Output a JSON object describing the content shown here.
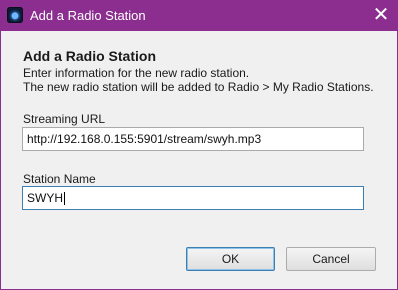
{
  "window": {
    "title": "Add a Radio Station",
    "close_label": "✕"
  },
  "dialog": {
    "heading": "Add a Radio Station",
    "description_line1": "Enter information for the new radio station.",
    "description_line2": "The new radio station will be added to Radio > My Radio Stations.",
    "streaming_url_label": "Streaming URL",
    "streaming_url_value": "http://192.168.0.155:5901/stream/swyh.mp3",
    "station_name_label": "Station Name",
    "station_name_value": "SWYH",
    "ok_label": "OK",
    "cancel_label": "Cancel"
  },
  "colors": {
    "titlebar": "#8b2e8f",
    "dialog_bg": "#f0f0f0",
    "focus_border": "#3c7fb1"
  }
}
